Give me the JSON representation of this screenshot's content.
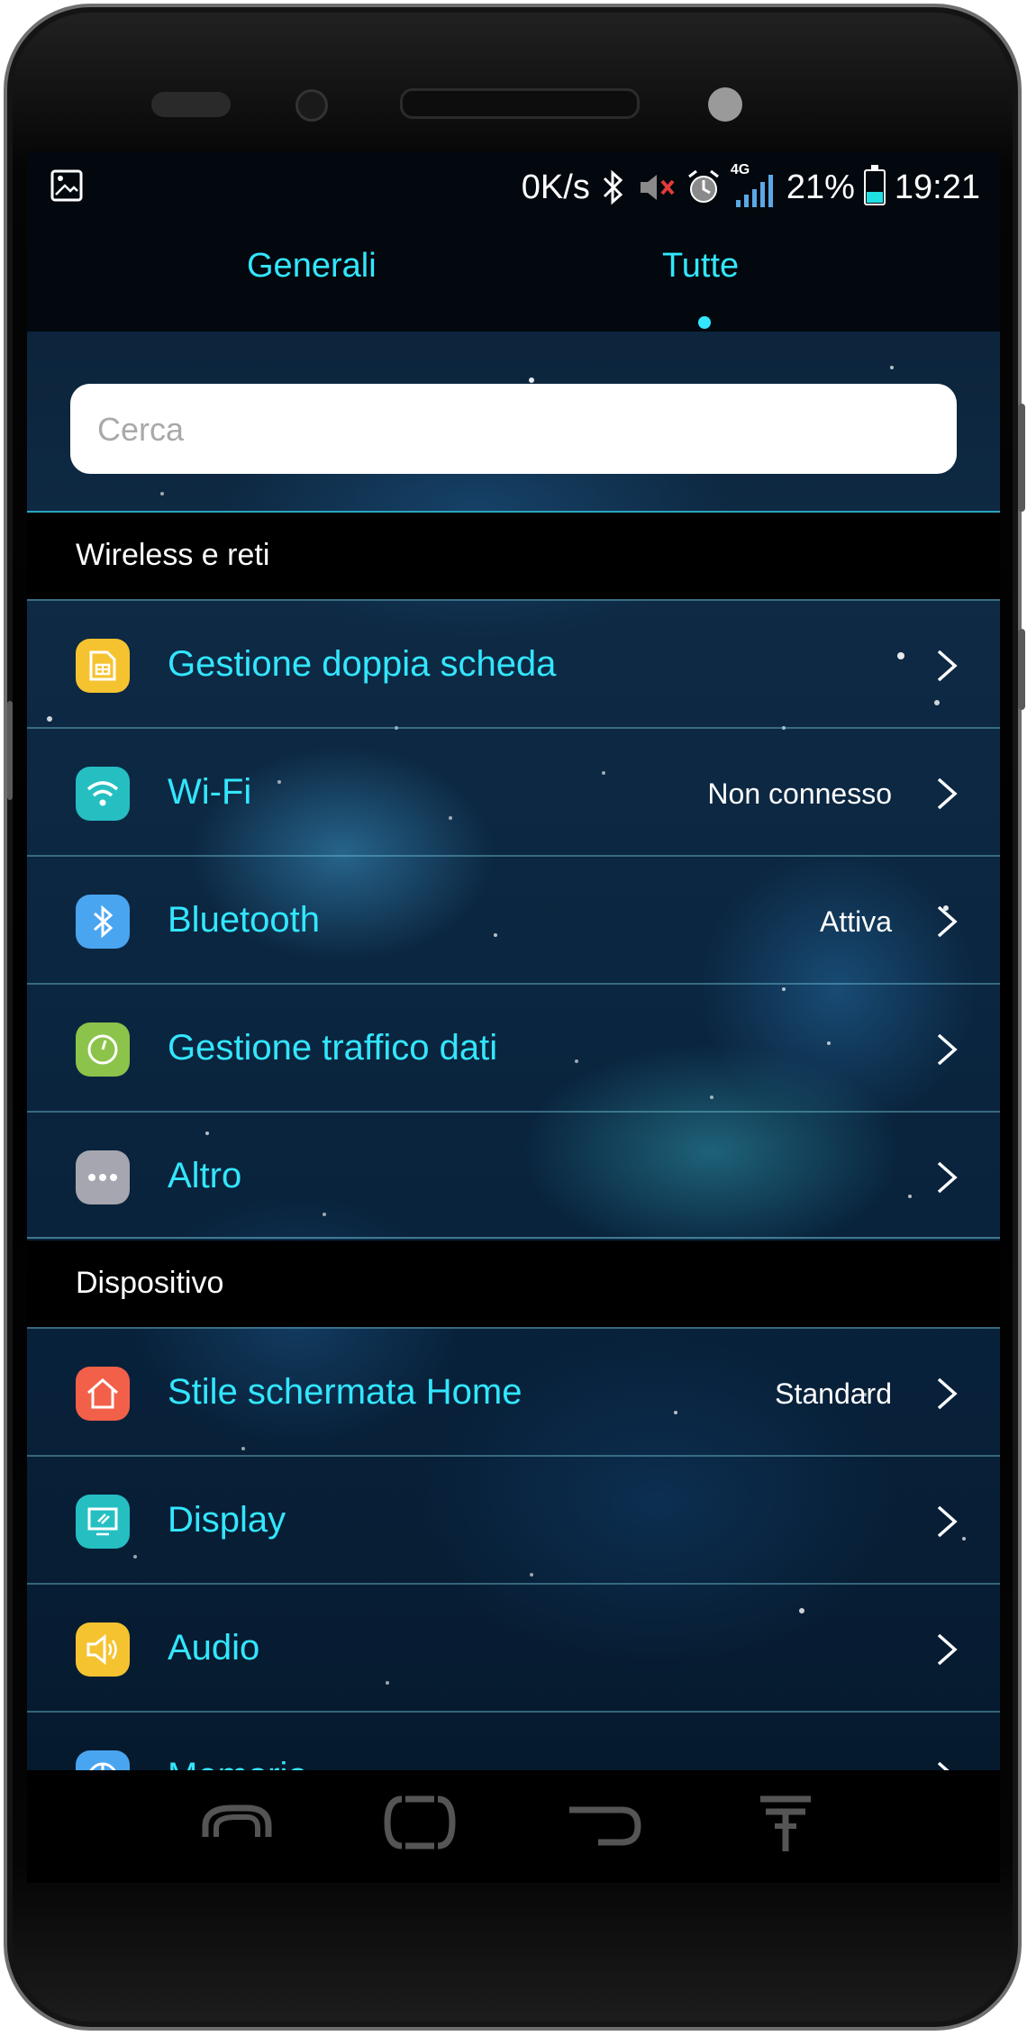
{
  "status_bar": {
    "net_speed": "0K/s",
    "network_type": "4G",
    "battery_percent": "21%",
    "battery_level": 0.21,
    "time": "19:21",
    "icons": [
      "gallery-icon",
      "bluetooth-icon",
      "mute-icon",
      "alarm-icon",
      "signal-icon",
      "battery-icon"
    ]
  },
  "tabs": [
    {
      "label": "Generali",
      "active": false
    },
    {
      "label": "Tutte",
      "active": true
    }
  ],
  "search": {
    "placeholder": "Cerca"
  },
  "sections": [
    {
      "title": "Wireless e reti",
      "items": [
        {
          "label": "Gestione doppia scheda",
          "value": "",
          "icon": "sim-card-icon",
          "icon_color": "#f5c330"
        },
        {
          "label": "Wi-Fi",
          "value": "Non connesso",
          "icon": "wifi-icon",
          "icon_color": "#25bfc2"
        },
        {
          "label": "Bluetooth",
          "value": "Attiva",
          "icon": "bluetooth-icon",
          "icon_color": "#4aa5f0"
        },
        {
          "label": "Gestione traffico dati",
          "value": "",
          "icon": "data-usage-icon",
          "icon_color": "#8cc34a"
        },
        {
          "label": "Altro",
          "value": "",
          "icon": "more-icon",
          "icon_color": "#a6a6b0"
        }
      ]
    },
    {
      "title": "Dispositivo",
      "items": [
        {
          "label": "Stile schermata Home",
          "value": "Standard",
          "icon": "home-icon",
          "icon_color": "#f3604a"
        },
        {
          "label": "Display",
          "value": "",
          "icon": "display-icon",
          "icon_color": "#25bfc2"
        },
        {
          "label": "Audio",
          "value": "",
          "icon": "speaker-icon",
          "icon_color": "#f5c330"
        },
        {
          "label": "Memoria",
          "value": "",
          "icon": "storage-icon",
          "icon_color": "#4aa5f0"
        }
      ]
    }
  ],
  "nav_bar": {
    "buttons": [
      "recent-apps-icon",
      "home-icon",
      "back-icon",
      "notification-pull-icon"
    ]
  },
  "colors": {
    "accent": "#33e6ff",
    "section_header_bg": "#000000",
    "status_bar_bg": "#02080e"
  }
}
